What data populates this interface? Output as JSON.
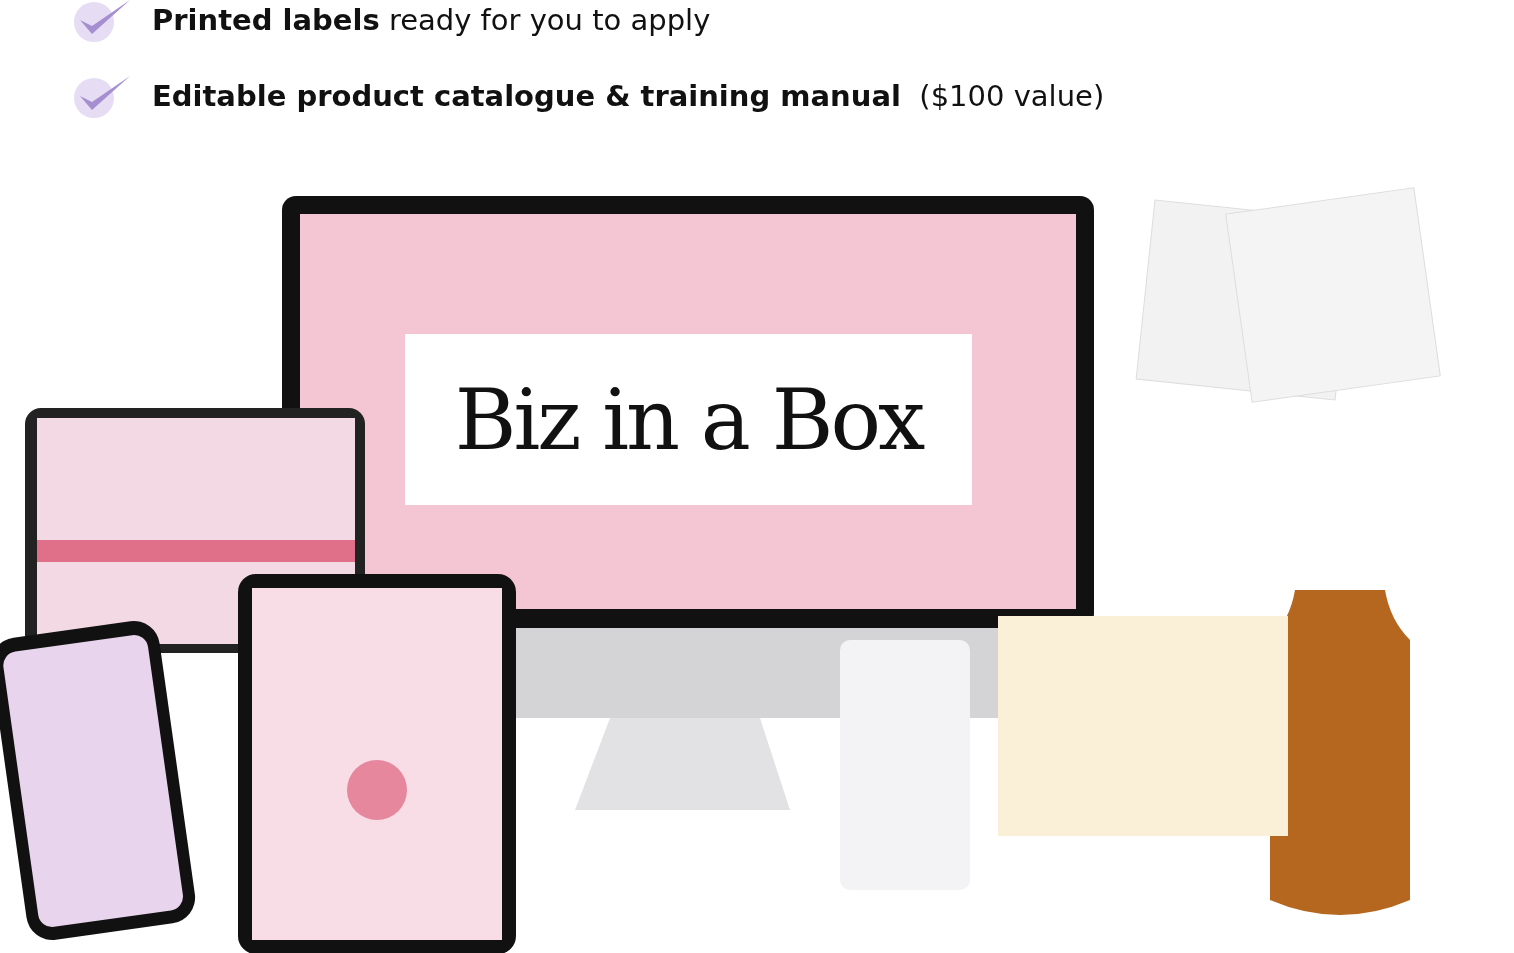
{
  "benefits": [
    {
      "text": "**Printed labels** ready for you to apply"
    },
    {
      "text": "**Editable product catalogue & training manual**  ($100 value)"
    }
  ],
  "hero": {
    "title": "Biz in a Box"
  }
}
